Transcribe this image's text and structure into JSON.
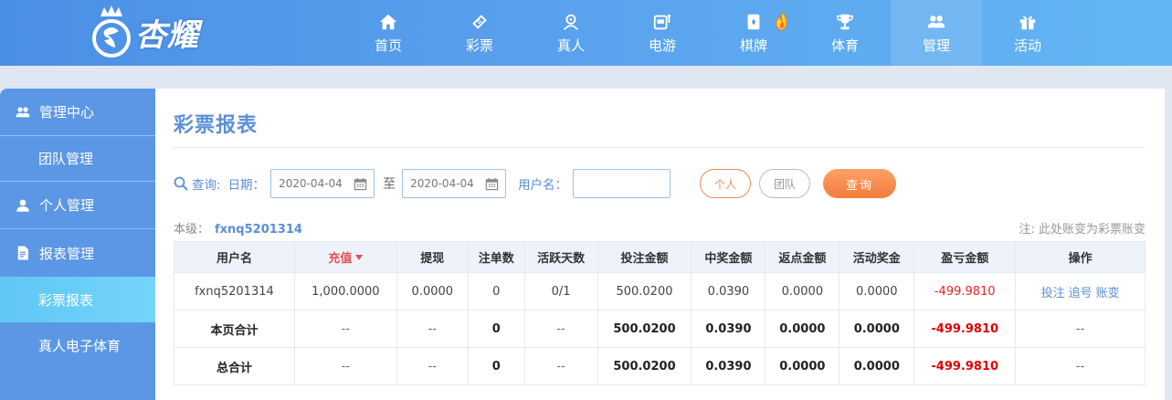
{
  "brand": {
    "name": "杏耀"
  },
  "nav": [
    {
      "label": "首页",
      "icon": "home-icon"
    },
    {
      "label": "彩票",
      "icon": "lottery-ticket-icon"
    },
    {
      "label": "真人",
      "icon": "live-dealer-icon"
    },
    {
      "label": "电游",
      "icon": "slot-machine-icon"
    },
    {
      "label": "棋牌",
      "icon": "card-game-icon"
    },
    {
      "label": "体育",
      "icon": "trophy-icon"
    },
    {
      "label": "管理",
      "icon": "users-icon"
    },
    {
      "label": "活动",
      "icon": "gift-icon"
    }
  ],
  "sidebar": {
    "items": [
      {
        "label": "管理中心",
        "type": "group",
        "icon": "users-icon"
      },
      {
        "label": "团队管理",
        "type": "sub"
      },
      {
        "label": "个人管理",
        "type": "group",
        "icon": "user-icon"
      },
      {
        "label": "报表管理",
        "type": "group",
        "icon": "report-icon"
      },
      {
        "label": "彩票报表",
        "type": "sub"
      },
      {
        "label": "真人电子体育",
        "type": "sub"
      }
    ]
  },
  "page": {
    "title": "彩票报表",
    "query": {
      "label": "查询:",
      "date_label": "日期：",
      "date_from": "2020-04-04",
      "between": "至",
      "date_to": "2020-04-04",
      "username_label": "用户名：",
      "username_value": "",
      "personal": "个人",
      "team": "团队",
      "search": "查询"
    },
    "level_label": "本级：",
    "level_user": "fxnq5201314",
    "note": "注: 此处账变为彩票账变"
  },
  "table": {
    "headers": [
      "用户名",
      "充值",
      "提现",
      "注单数",
      "活跃天数",
      "投注金额",
      "中奖金额",
      "返点金额",
      "活动奖金",
      "盈亏金额",
      "操作"
    ],
    "rows": [
      {
        "cells": [
          "fxnq5201314",
          "1,000.0000",
          "0.0000",
          "0",
          "0/1",
          "500.0200",
          "0.0390",
          "0.0000",
          "0.0000",
          "-499.9810"
        ],
        "ops": [
          "投注",
          "追号",
          "账变"
        ]
      }
    ],
    "summary": [
      {
        "cells": [
          "本页合计",
          "--",
          "--",
          "0",
          "--",
          "500.0200",
          "0.0390",
          "0.0000",
          "0.0000",
          "-499.9810",
          "--"
        ]
      },
      {
        "cells": [
          "总合计",
          "--",
          "--",
          "0",
          "--",
          "500.0200",
          "0.0390",
          "0.0000",
          "0.0000",
          "-499.9810",
          "--"
        ]
      }
    ]
  }
}
